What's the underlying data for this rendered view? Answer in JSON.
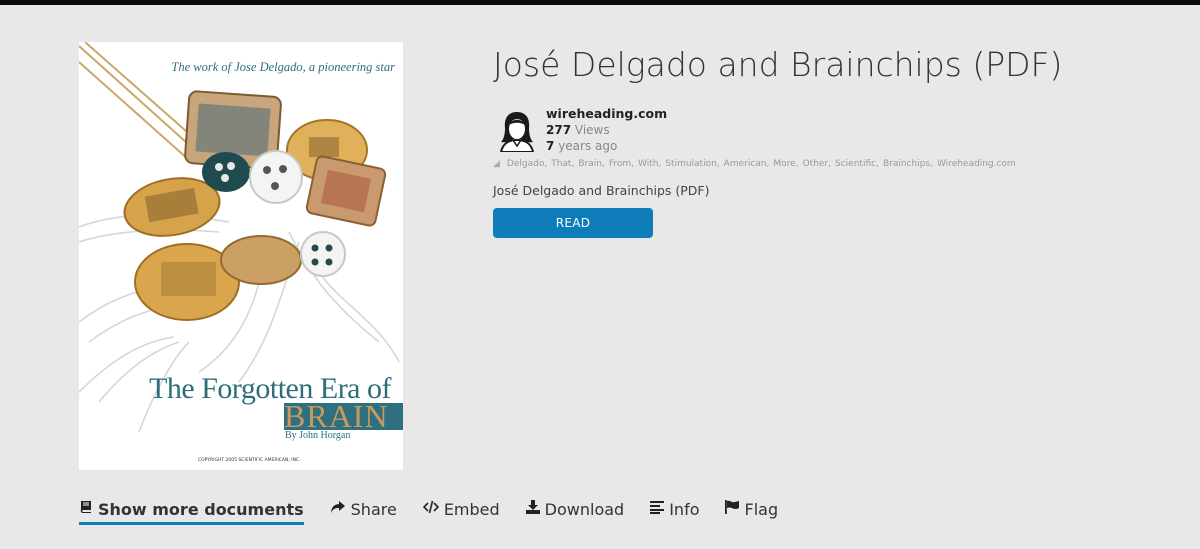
{
  "cover": {
    "tagline": "The work of Jose Delgado, a pioneering star",
    "title_line1": "The Forgotten Era of",
    "title_line2": "BRAIN",
    "byline": "By John Horgan",
    "copyright": "COPYRIGHT 2005 SCIENTIFIC AMERICAN, INC."
  },
  "document": {
    "title": "José Delgado and Brainchips (PDF)",
    "subtitle": "José Delgado and Brainchips (PDF)",
    "read_label": "READ"
  },
  "author": {
    "name": "wireheading.com",
    "views_count": "277",
    "views_label": "Views",
    "age_count": "7",
    "age_label": "years ago",
    "avatar_icon": "user-avatar-icon"
  },
  "tags": [
    "Delgado",
    "That",
    "Brain",
    "From",
    "With",
    "Stimulation",
    "American",
    "More",
    "Other",
    "Scientific",
    "Brainchips",
    "Wireheading.com"
  ],
  "actions": [
    {
      "label": "Show more documents",
      "icon": "book-icon"
    },
    {
      "label": "Share",
      "icon": "share-icon"
    },
    {
      "label": "Embed",
      "icon": "code-icon"
    },
    {
      "label": "Download",
      "icon": "download-icon"
    },
    {
      "label": "Info",
      "icon": "list-icon"
    },
    {
      "label": "Flag",
      "icon": "flag-icon"
    }
  ],
  "colors": {
    "accent": "#0e7cb8",
    "background": "#e8e8e8",
    "topbar": "#0b0b0b",
    "cover_teal": "#2c6e7a"
  }
}
